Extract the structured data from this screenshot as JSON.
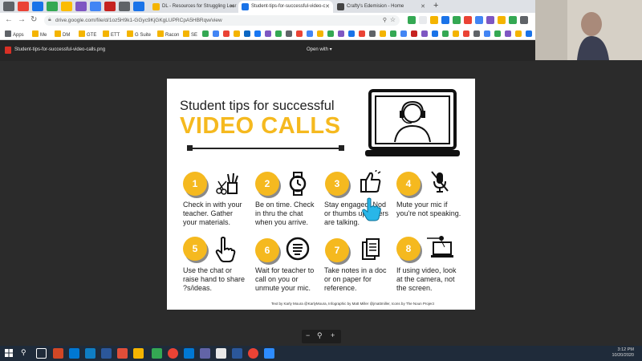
{
  "browser": {
    "tabs": [
      {
        "label": "DL - Resources for Struggling Lear",
        "color": "#f4b400"
      },
      {
        "label": "Student-tips-for-successful-video-c",
        "color": "#1a73e8"
      },
      {
        "label": "Crafty's Edemision - Home",
        "color": "#444444"
      }
    ],
    "new_tab": "+",
    "url": "drive.google.com/file/d/1oz5H9k1-GGyc9KjGKgLUPRCpA5HBRqw/view",
    "bookmarks": [
      {
        "label": "Apps",
        "color": "#5f6368"
      },
      {
        "label": "Me",
        "color": "#f4b400"
      },
      {
        "label": "DM",
        "color": "#f4b400"
      },
      {
        "label": "GTE",
        "color": "#f4b400"
      },
      {
        "label": "ETT",
        "color": "#f4b400"
      },
      {
        "label": "G Suite",
        "color": "#f4b400"
      },
      {
        "label": "Racon",
        "color": "#f4b400"
      },
      {
        "label": "SE",
        "color": "#f4b400"
      }
    ]
  },
  "viewer": {
    "file_name": "Student-tips-for-successful-video-calls.png",
    "open_with": "Open with ▾",
    "zoom_out": "−",
    "zoom_icon": "⚲",
    "zoom_in": "+"
  },
  "infographic": {
    "title_line1": "Student tips for successful",
    "title_line2": "VIDEO CALLS",
    "accent_color": "#f5b91f",
    "tips": [
      {
        "num": "1",
        "text": "Check in with your teacher. Gather your materials.",
        "icon": "scissors-pencils-icon"
      },
      {
        "num": "2",
        "text": "Be on time. Check in thru the chat when you arrive.",
        "icon": "watch-icon"
      },
      {
        "num": "3",
        "text": "Stay engaged. Nod or thumbs up others are talking.",
        "icon": "thumbs-up-icon"
      },
      {
        "num": "4",
        "text": "Mute your mic if you're not speaking.",
        "icon": "muted-mic-icon"
      },
      {
        "num": "5",
        "text": "Use the chat or raise hand to share ?s/ideas.",
        "icon": "raised-hand-icon"
      },
      {
        "num": "6",
        "text": "Wait for teacher to call on you or unmute your mic.",
        "icon": "hand-wait-icon"
      },
      {
        "num": "7",
        "text": "Take notes in a doc or on paper for reference.",
        "icon": "documents-icon"
      },
      {
        "num": "8",
        "text": "If using video, look at the camera, not the screen.",
        "icon": "camera-laptop-icon"
      }
    ],
    "credits": "Text by Karly Moura @KarlyMoura, Infographic by Matt Miller @jmattmiller, Icons by The Noun Project"
  },
  "taskbar": {
    "time": "3:12 PM",
    "date": "10/20/2020"
  }
}
